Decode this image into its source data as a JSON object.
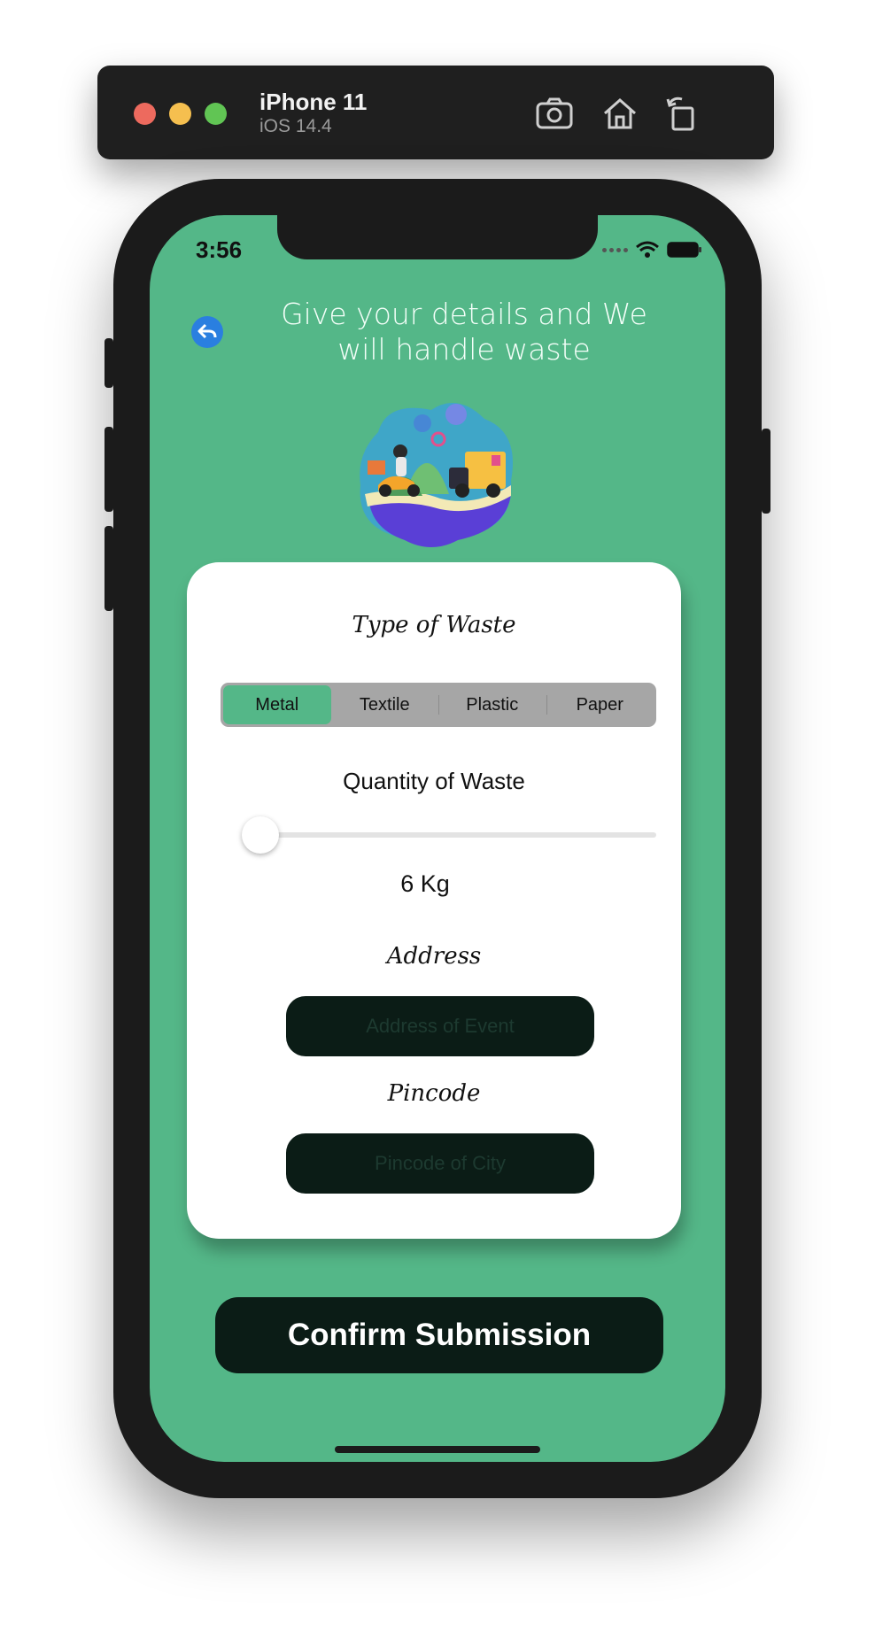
{
  "simulator": {
    "device_name": "iPhone 11",
    "os_version": "iOS 14.4",
    "icons": [
      "screenshot-icon",
      "home-icon",
      "rotate-icon"
    ]
  },
  "status_bar": {
    "time": "3:56",
    "icons": [
      "signal-dots-icon",
      "wifi-icon",
      "battery-icon"
    ]
  },
  "header": {
    "title": "Give your details and We will handle waste",
    "back_icon": "back-arrow-icon"
  },
  "illustration": {
    "name": "delivery-scooter-truck-illustration"
  },
  "form": {
    "type_label": "Type of Waste",
    "waste_types": [
      "Metal",
      "Textile",
      "Plastic",
      "Paper"
    ],
    "selected_type": "Metal",
    "quantity_label": "Quantity of Waste",
    "quantity_value": "6 Kg",
    "address_label": "Address",
    "address_placeholder": "Address of Event",
    "address_value": "",
    "pincode_label": "Pincode",
    "pincode_placeholder": "Pincode of City",
    "pincode_value": ""
  },
  "actions": {
    "confirm_label": "Confirm Submission"
  },
  "colors": {
    "accent_green": "#54b788",
    "dark_button": "#0b1c16",
    "back_button": "#2a7fe0"
  }
}
